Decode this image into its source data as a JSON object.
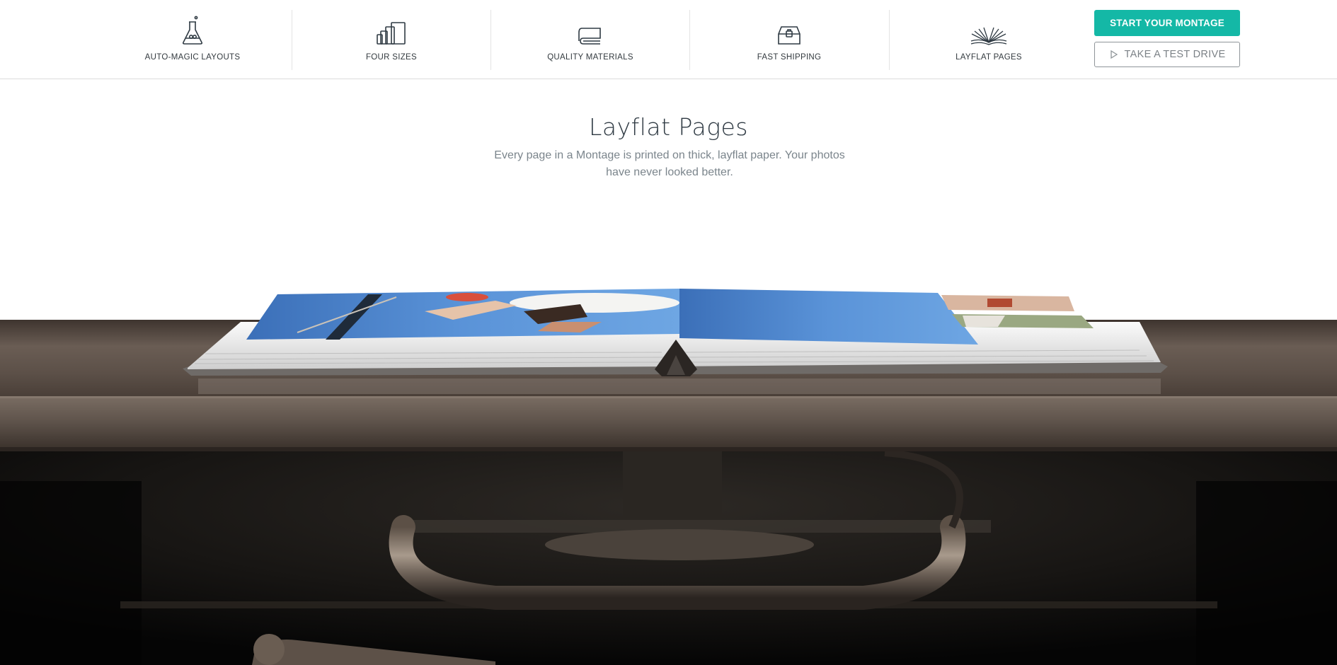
{
  "nav": {
    "features": [
      {
        "label": "AUTO-MAGIC LAYOUTS",
        "icon": "flask-icon"
      },
      {
        "label": "FOUR SIZES",
        "icon": "book-sizes-icon"
      },
      {
        "label": "QUALITY MATERIALS",
        "icon": "book-stack-icon"
      },
      {
        "label": "FAST SHIPPING",
        "icon": "box-icon"
      },
      {
        "label": "LAYFLAT PAGES",
        "icon": "open-book-icon"
      }
    ],
    "start_label": "START YOUR MONTAGE",
    "test_label": "TAKE A TEST DRIVE"
  },
  "hero": {
    "title": "Layflat Pages",
    "subtitle": "Every page in a Montage is printed on thick, layflat paper. Your photos have never looked better."
  },
  "colors": {
    "accent": "#14b8a6",
    "text_dark": "#2f3a43",
    "text_muted": "#7b858c"
  }
}
